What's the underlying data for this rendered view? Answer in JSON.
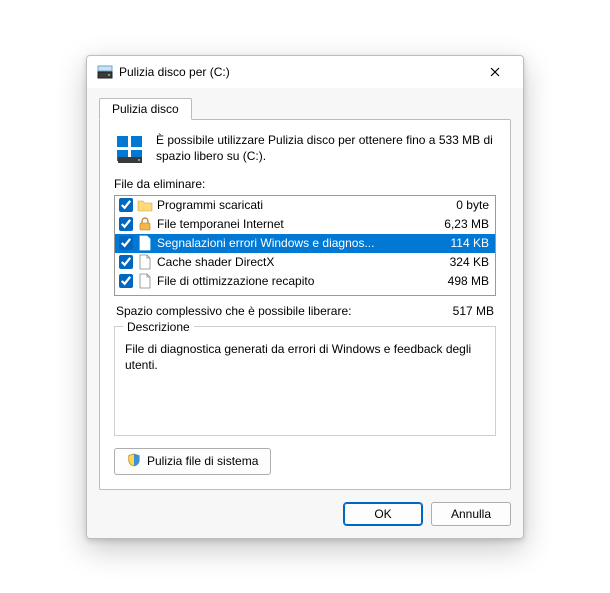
{
  "window": {
    "title": "Pulizia disco per  (C:)"
  },
  "tab": {
    "label": "Pulizia disco"
  },
  "intro": "È possibile utilizzare Pulizia disco per ottenere fino a 533 MB di spazio libero su  (C:).",
  "files_label": "File da eliminare:",
  "files": [
    {
      "checked": true,
      "icon": "folder",
      "name": "Programmi scaricati",
      "size": "0 byte",
      "selected": false
    },
    {
      "checked": true,
      "icon": "lock",
      "name": "File temporanei Internet",
      "size": "6,23 MB",
      "selected": false
    },
    {
      "checked": true,
      "icon": "file-sel",
      "name": "Segnalazioni errori Windows e diagnos...",
      "size": "114 KB",
      "selected": true
    },
    {
      "checked": true,
      "icon": "file",
      "name": "Cache shader DirectX",
      "size": "324 KB",
      "selected": false
    },
    {
      "checked": true,
      "icon": "file",
      "name": "File di ottimizzazione recapito",
      "size": "498 MB",
      "selected": false
    }
  ],
  "total": {
    "label": "Spazio complessivo che è possibile liberare:",
    "value": "517 MB"
  },
  "description": {
    "legend": "Descrizione",
    "text": "File di diagnostica generati da errori di Windows e feedback degli utenti."
  },
  "system_files_btn": "Pulizia file di sistema",
  "buttons": {
    "ok": "OK",
    "cancel": "Annulla"
  }
}
